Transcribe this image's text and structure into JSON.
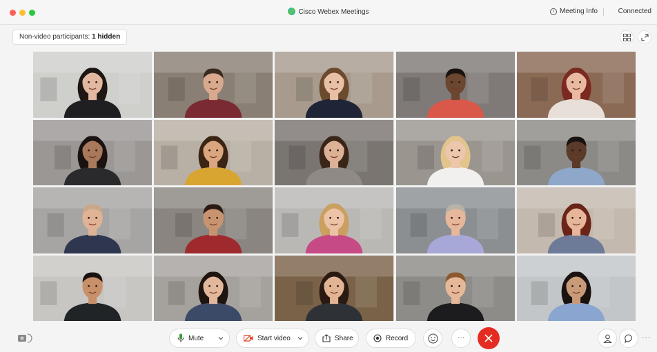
{
  "window": {
    "title": "Cisco Webex Meetings",
    "meeting_info_label": "Meeting Info",
    "connection_status": "Connected"
  },
  "toolbar_top": {
    "non_video_label": "Non-video participants:",
    "non_video_count": "1 hidden",
    "layout_icon": "grid-layout-icon",
    "expand_icon": "expand-icon"
  },
  "participants": [
    {
      "bg": "#cfcfcc",
      "skin": "#e3b8a0",
      "hair": "#1e1612",
      "shirt": "#1f1f22",
      "long_hair": true
    },
    {
      "bg": "#8a7f74",
      "skin": "#d8a98c",
      "hair": "#3a2a20",
      "shirt": "#7a2a33",
      "long_hair": false
    },
    {
      "bg": "#a89b8e",
      "skin": "#e7c0a5",
      "hair": "#6b4a2e",
      "shirt": "#1f2436",
      "long_hair": true
    },
    {
      "bg": "#7f7a78",
      "skin": "#6b4631",
      "hair": "#1a120e",
      "shirt": "#d9584a",
      "long_hair": false
    },
    {
      "bg": "#8b6a55",
      "skin": "#e9b9a2",
      "hair": "#7a2a20",
      "shirt": "#e8e0d8",
      "long_hair": true
    },
    {
      "bg": "#9a9795",
      "skin": "#a8795a",
      "hair": "#1a1210",
      "shirt": "#2a2a2c",
      "long_hair": true
    },
    {
      "bg": "#b8b0a4",
      "skin": "#d9a680",
      "hair": "#3b2414",
      "shirt": "#d9a531",
      "long_hair": true
    },
    {
      "bg": "#7a7571",
      "skin": "#dcb196",
      "hair": "#3a2618",
      "shirt": "#8f8a86",
      "long_hair": true
    },
    {
      "bg": "#9a958f",
      "skin": "#ecc7ae",
      "hair": "#e2c48c",
      "shirt": "#f2f0ee",
      "long_hair": true
    },
    {
      "bg": "#8c8a86",
      "skin": "#5a3a28",
      "hair": "#1a1210",
      "shirt": "#8fa7c8",
      "long_hair": false
    },
    {
      "bg": "#a7a5a3",
      "skin": "#e0b296",
      "hair": "#c9a88a",
      "shirt": "#2e3650",
      "long_hair": false
    },
    {
      "bg": "#8a8580",
      "skin": "#c89470",
      "hair": "#2a1a12",
      "shirt": "#9e2a2e",
      "long_hair": false
    },
    {
      "bg": "#b9b8b5",
      "skin": "#ecc3a6",
      "hair": "#c9a060",
      "shirt": "#c64a86",
      "long_hair": true
    },
    {
      "bg": "#8b8f92",
      "skin": "#e7b79b",
      "hair": "#b9b2a8",
      "shirt": "#a8a8d8",
      "long_hair": false
    },
    {
      "bg": "#c4b9ae",
      "skin": "#e6b69a",
      "hair": "#6a2418",
      "shirt": "#6d7a98",
      "long_hair": true
    },
    {
      "bg": "#c8c6c3",
      "skin": "#c89068",
      "hair": "#1a1210",
      "shirt": "#202426",
      "long_hair": false
    },
    {
      "bg": "#a5a29e",
      "skin": "#e2b89c",
      "hair": "#1e1410",
      "shirt": "#3b4a66",
      "long_hair": true
    },
    {
      "bg": "#7a6248",
      "skin": "#e2b494",
      "hair": "#2a1a12",
      "shirt": "#2e3236",
      "long_hair": true
    },
    {
      "bg": "#8e8c88",
      "skin": "#e6b89a",
      "hair": "#8a5a2e",
      "shirt": "#1c1c1e",
      "long_hair": false
    },
    {
      "bg": "#c2c6c8",
      "skin": "#c99a78",
      "hair": "#1a1210",
      "shirt": "#8aa6d0",
      "long_hair": true
    }
  ],
  "controls": {
    "mute_label": "Mute",
    "start_video_label": "Start video",
    "share_label": "Share",
    "record_label": "Record",
    "more_label": "···",
    "more_right_label": "···"
  },
  "colors": {
    "end_call": "#e52c23",
    "video_icon": "#e0401f",
    "mic_icon": "#3a9a3a"
  }
}
